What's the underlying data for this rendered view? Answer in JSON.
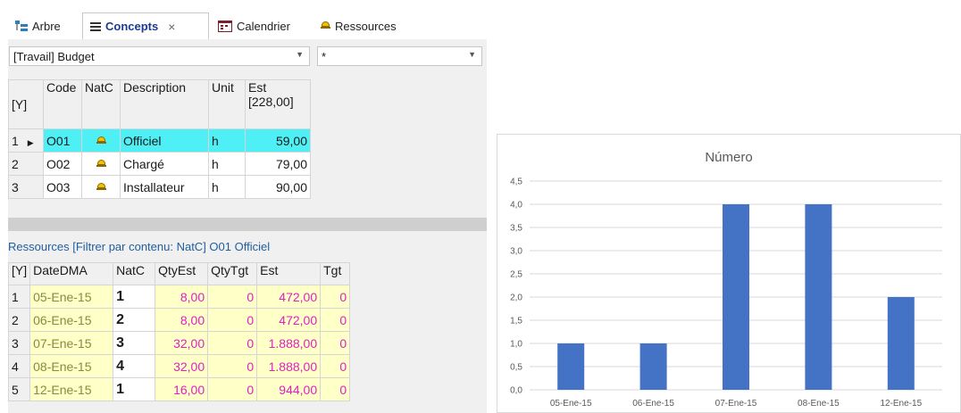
{
  "tabs": [
    {
      "label": "Arbre",
      "icon": "tree-icon"
    },
    {
      "label": "Concepts",
      "icon": "list-icon",
      "close": "×"
    },
    {
      "label": "Calendrier",
      "icon": "calendar-icon"
    },
    {
      "label": "Ressources",
      "icon": "hardhat-icon"
    }
  ],
  "filters": {
    "main": "[Travail] Budget",
    "secondary": "*"
  },
  "concepts": {
    "headers": {
      "rownum": "[Y]",
      "code": "Code",
      "natc": "NatC",
      "description": "Description",
      "unit": "Unit",
      "est": "Est",
      "est_total": "[228,00]"
    },
    "rows": [
      {
        "n": "1",
        "code": "O01",
        "description": "Officiel",
        "unit": "h",
        "est": "59,00"
      },
      {
        "n": "2",
        "code": "O02",
        "description": "Chargé",
        "unit": "h",
        "est": "79,00"
      },
      {
        "n": "3",
        "code": "O03",
        "description": "Installateur",
        "unit": "h",
        "est": "90,00"
      }
    ]
  },
  "resources": {
    "caption": "Ressources [Filtrer par contenu: NatC]  O01 Officiel",
    "headers": {
      "rownum": "[Y]",
      "date": "DateDMA",
      "natc": "NatC",
      "qtyest": "QtyEst",
      "qtytgt": "QtyTgt",
      "est": "Est",
      "tgt": "Tgt"
    },
    "rows": [
      {
        "n": "1",
        "date": "05-Ene-15",
        "natc": "1",
        "qtyest": "8,00",
        "qtytgt": "0",
        "est": "472,00",
        "tgt": "0"
      },
      {
        "n": "2",
        "date": "06-Ene-15",
        "natc": "2",
        "qtyest": "8,00",
        "qtytgt": "0",
        "est": "472,00",
        "tgt": "0"
      },
      {
        "n": "3",
        "date": "07-Ene-15",
        "natc": "3",
        "qtyest": "32,00",
        "qtytgt": "0",
        "est": "1.888,00",
        "tgt": "0"
      },
      {
        "n": "4",
        "date": "08-Ene-15",
        "natc": "4",
        "qtyest": "32,00",
        "qtytgt": "0",
        "est": "1.888,00",
        "tgt": "0"
      },
      {
        "n": "5",
        "date": "12-Ene-15",
        "natc": "1",
        "qtyest": "16,00",
        "qtytgt": "0",
        "est": "944,00",
        "tgt": "0"
      }
    ]
  },
  "chart_data": {
    "type": "bar",
    "title": "Número",
    "categories": [
      "05-Ene-15",
      "06-Ene-15",
      "07-Ene-15",
      "08-Ene-15",
      "12-Ene-15"
    ],
    "values": [
      1,
      1,
      4,
      4,
      2
    ],
    "ylim": [
      0,
      4.5
    ],
    "yticks": [
      "0,0",
      "0,5",
      "1,0",
      "1,5",
      "2,0",
      "2,5",
      "3,0",
      "3,5",
      "4,0",
      "4,5"
    ],
    "grid": true,
    "bar_color": "#4472c4"
  }
}
